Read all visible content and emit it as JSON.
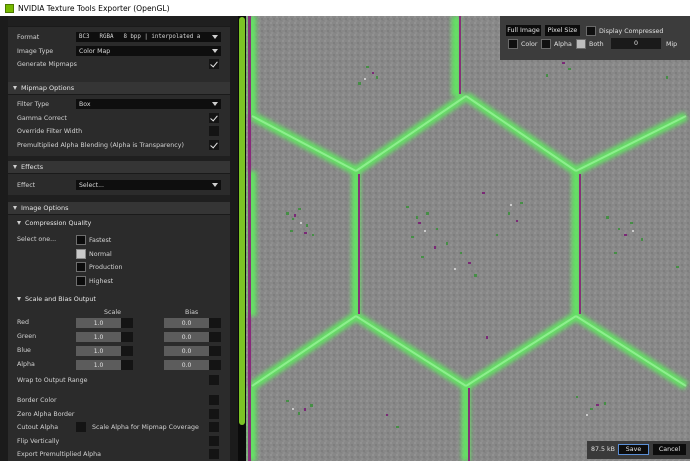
{
  "window": {
    "title": "NVIDIA Texture Tools Exporter (OpenGL)"
  },
  "general": {
    "format_label": "Format",
    "format_parts": [
      "BC3",
      "RGBA",
      "8 bpp | interpolated a"
    ],
    "image_type_label": "Image Type",
    "image_type_value": "Color Map",
    "generate_mipmaps_label": "Generate Mipmaps",
    "generate_mipmaps_checked": true
  },
  "mipmap": {
    "header": "Mipmap Options",
    "filter_type_label": "Filter Type",
    "filter_type_value": "Box",
    "gamma_correct_label": "Gamma Correct",
    "gamma_correct_checked": true,
    "override_filter_width_label": "Override Filter Width",
    "override_filter_width_checked": false,
    "premultiplied_label": "Premultiplied Alpha Blending (Alpha is Transparency)",
    "premultiplied_checked": true
  },
  "effects": {
    "header": "Effects",
    "effect_label": "Effect",
    "effect_value": "Select..."
  },
  "image_options": {
    "header": "Image Options",
    "compression_quality": {
      "header": "Compression Quality",
      "select_label": "Select one...",
      "options": [
        "Fastest",
        "Normal",
        "Production",
        "Highest"
      ],
      "selected": "Normal"
    },
    "scale_bias": {
      "header": "Scale and Bias Output",
      "scale_label": "Scale",
      "bias_label": "Bias",
      "channels": [
        {
          "name": "Red",
          "scale": "1.0",
          "bias": "0.0"
        },
        {
          "name": "Green",
          "scale": "1.0",
          "bias": "0.0"
        },
        {
          "name": "Blue",
          "scale": "1.0",
          "bias": "0.0"
        },
        {
          "name": "Alpha",
          "scale": "1.0",
          "bias": "0.0"
        }
      ],
      "wrap_label": "Wrap to Output Range"
    },
    "border_color_label": "Border Color",
    "zero_alpha_border_label": "Zero Alpha Border",
    "cutout_alpha_label": "Cutout Alpha",
    "scale_alpha_label": "Scale Alpha for Mipmap Coverage",
    "flip_vertically_label": "Flip Vertically",
    "export_premultiplied_label": "Export Premultiplied Alpha"
  },
  "view_controls": {
    "full_image": "Full Image",
    "pixel_size": "Pixel Size",
    "display_compressed": "Display Compressed",
    "color": "Color",
    "alpha": "Alpha",
    "both": "Both",
    "both_checked": true,
    "mip_value": "0",
    "mip_label": "Mip"
  },
  "footer": {
    "file_size": "87.5 kB",
    "save": "Save",
    "cancel": "Cancel"
  },
  "colors": {
    "accent_green": "#7cc425",
    "glow_green": "#6df06d",
    "seam_purple": "#8a1f7a"
  }
}
